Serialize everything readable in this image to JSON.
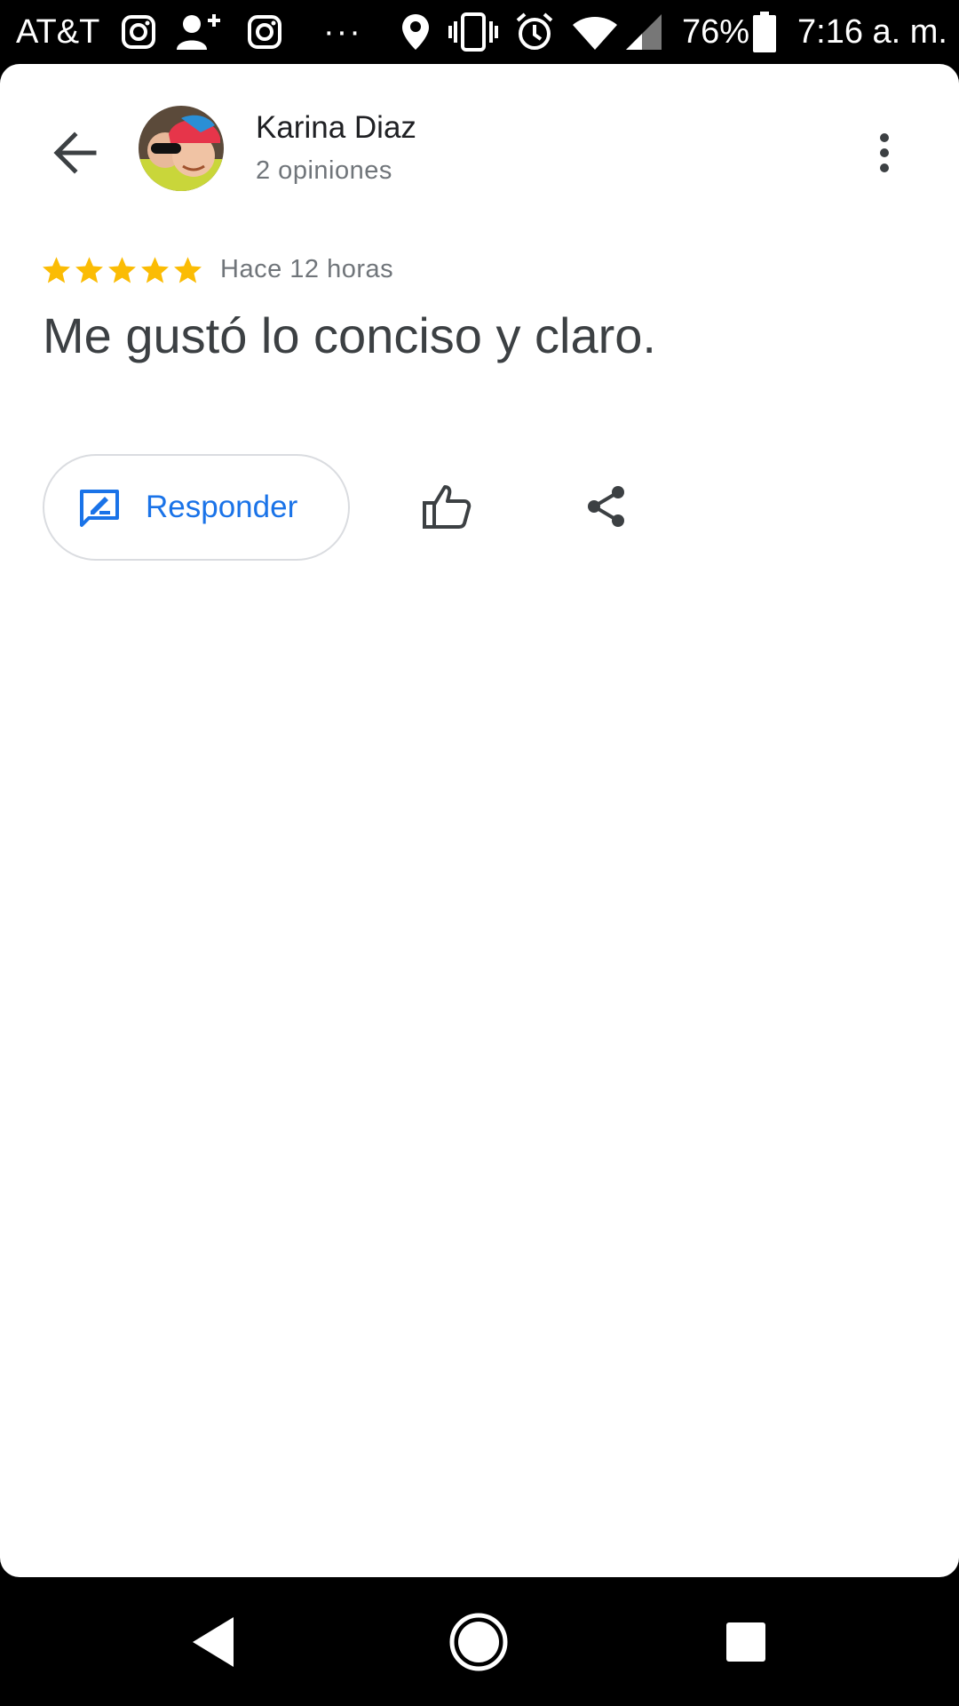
{
  "status_bar": {
    "carrier": "AT&T",
    "more_indicator": "···",
    "battery": "76%",
    "time": "7:16 a. m.",
    "icons": [
      "instagram-icon",
      "add-person-icon",
      "instagram-icon",
      "location-icon",
      "vibrate-icon",
      "alarm-icon",
      "wifi-icon",
      "signal-icon",
      "battery-icon"
    ]
  },
  "review": {
    "reviewer_name": "Karina Diaz",
    "review_count": "2 opiniones",
    "rating": 5,
    "time_ago": "Hace 12 horas",
    "text": "Me gustó lo conciso y claro."
  },
  "actions": {
    "reply_label": "Responder"
  },
  "colors": {
    "accent": "#1a73e8",
    "star": "#fbbc04",
    "primary_text": "#202124",
    "secondary_text": "#70757a"
  }
}
